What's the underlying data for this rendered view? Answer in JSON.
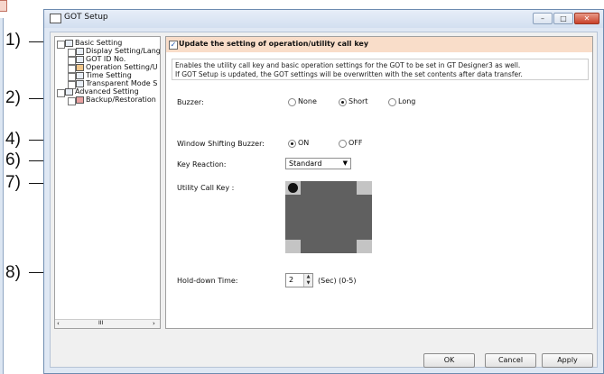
{
  "window": {
    "title": "GOT Setup"
  },
  "callouts": [
    "1)",
    "2)",
    "4)",
    "6)",
    "7)",
    "8)"
  ],
  "tree": {
    "items": [
      {
        "label": "Basic Setting"
      },
      {
        "label": "Display Setting/Lang"
      },
      {
        "label": "GOT ID No."
      },
      {
        "label": "Operation Setting/U"
      },
      {
        "label": "Time Setting"
      },
      {
        "label": "Transparent Mode S"
      },
      {
        "label": "Advanced Setting"
      },
      {
        "label": "Backup/Restoration"
      }
    ],
    "scroll_thumb": "III"
  },
  "header": {
    "checkbox_label": "Update the setting of operation/utility call key",
    "checked": true
  },
  "description": {
    "line1": "Enables the utility call key and basic operation settings for the GOT to be set in GT Designer3 as well.",
    "line2": "If GOT Setup is updated, the GOT settings will be overwritten with the set contents after data transfer."
  },
  "buzzer": {
    "label": "Buzzer:",
    "options": [
      "None",
      "Short",
      "Long"
    ],
    "selected": "Short"
  },
  "window_shift_buzzer": {
    "label": "Window Shifting Buzzer:",
    "options": [
      "ON",
      "OFF"
    ],
    "selected": "ON"
  },
  "key_reaction": {
    "label": "Key Reaction:",
    "value": "Standard"
  },
  "utility_call_key": {
    "label": "Utility Call Key :"
  },
  "hold_down": {
    "label": "Hold-down Time:",
    "value": "2",
    "unit": "(Sec) (0-5)"
  },
  "buttons": {
    "ok": "OK",
    "cancel": "Cancel",
    "apply": "Apply"
  },
  "colors": {
    "header_bg": "#f9ddc9",
    "key_area": "#606060",
    "key_corner": "#c4c4c4"
  }
}
